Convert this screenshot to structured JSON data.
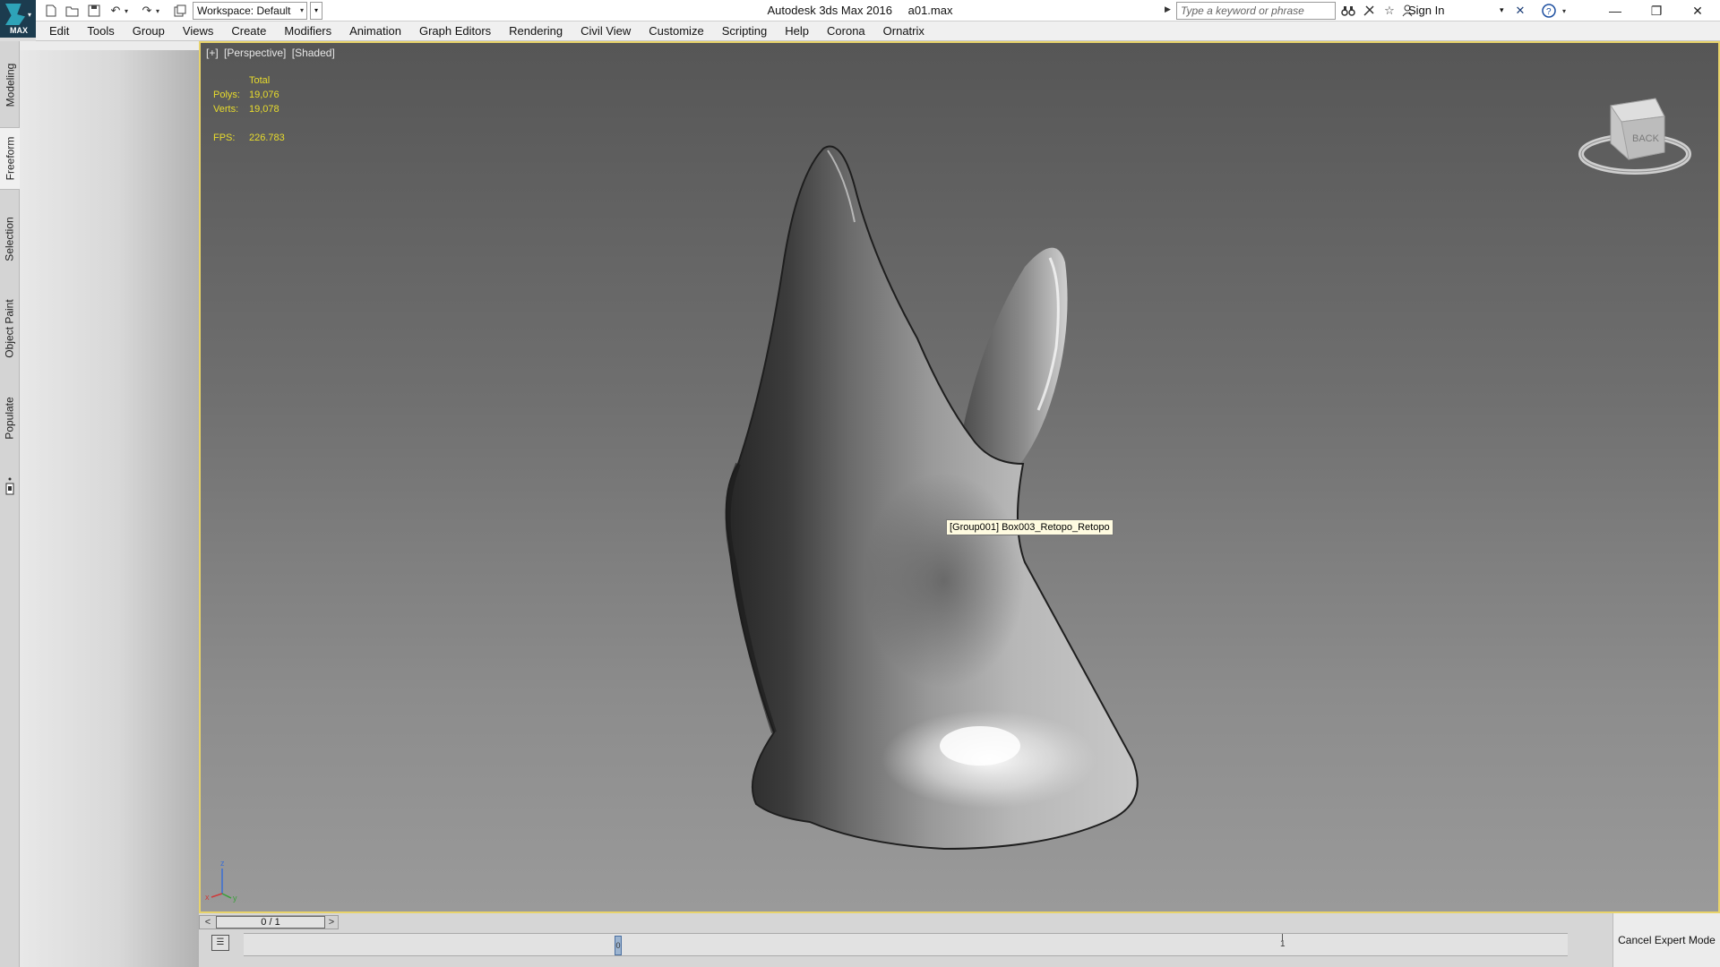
{
  "app": {
    "logo_text": "MAX",
    "title": "Autodesk 3ds Max 2016",
    "filename": "a01.max"
  },
  "quick_access": {
    "workspace_label": "Workspace: Default",
    "icons": [
      "new-file-icon",
      "open-file-icon",
      "save-icon",
      "undo-icon",
      "redo-icon",
      "project-folder-icon"
    ]
  },
  "infocenter": {
    "search_placeholder": "Type a keyword or phrase",
    "sign_in": "Sign In",
    "icons": [
      "binoculars-icon",
      "connect-icon",
      "star-icon",
      "user-icon",
      "exchange-icon",
      "help-icon"
    ]
  },
  "window_controls": [
    "minimize",
    "restore",
    "close"
  ],
  "menu": [
    "Edit",
    "Tools",
    "Group",
    "Views",
    "Create",
    "Modifiers",
    "Animation",
    "Graph Editors",
    "Rendering",
    "Civil View",
    "Customize",
    "Scripting",
    "Help",
    "Corona",
    "Ornatrix"
  ],
  "ribbon_tabs": [
    {
      "label": "Modeling",
      "active": false
    },
    {
      "label": "Freeform",
      "active": true
    },
    {
      "label": "Selection",
      "active": false
    },
    {
      "label": "Object Paint",
      "active": false
    },
    {
      "label": "Populate",
      "active": false
    }
  ],
  "viewport": {
    "label_parts": [
      "[+]",
      "[Perspective]",
      "[Shaded]"
    ],
    "stats": {
      "header": "Total",
      "polys_label": "Polys:",
      "polys": "19,076",
      "verts_label": "Verts:",
      "verts": "19,078",
      "fps_label": "FPS:",
      "fps": "226.783"
    },
    "tooltip": "[Group001] Box003_Retopo_Retopo",
    "viewcube_face": "BACK",
    "axes": {
      "z": "z",
      "x": "x",
      "y": "y"
    }
  },
  "timeline": {
    "prev": "<",
    "position": "0 / 1",
    "next": ">",
    "key_label": "0",
    "tick_label": "1"
  },
  "cancel_expert_mode": "Cancel Expert Mode"
}
